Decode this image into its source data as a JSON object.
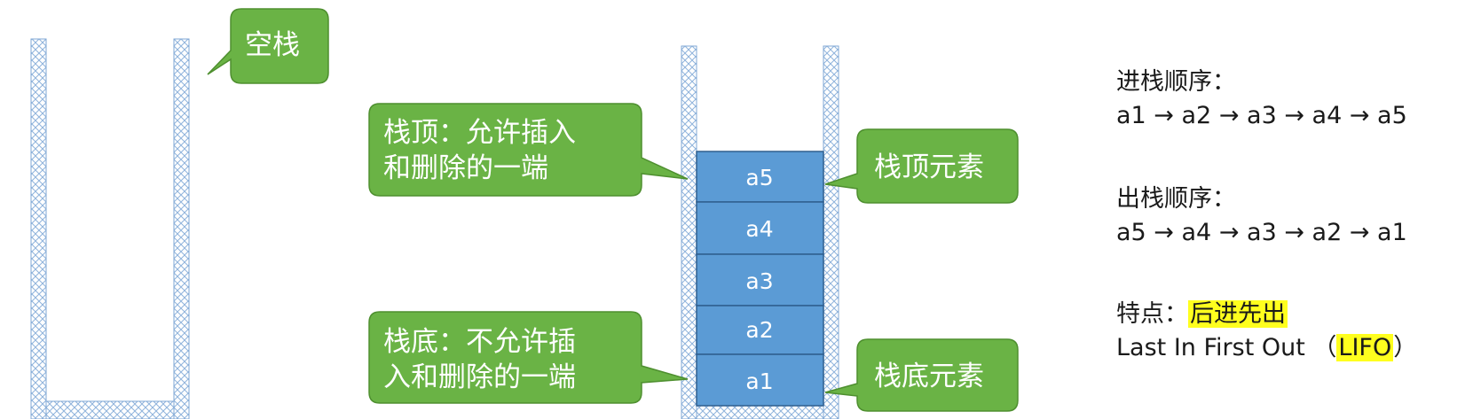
{
  "callouts": {
    "empty_stack": "空栈",
    "top_line1": "栈顶：允许插入",
    "top_line2": "和删除的一端",
    "bottom_line1": "栈底：不允许插",
    "bottom_line2": "入和删除的一端",
    "top_element": "栈顶元素",
    "bottom_element": "栈底元素"
  },
  "stack": {
    "elements": [
      "a5",
      "a4",
      "a3",
      "a2",
      "a1"
    ]
  },
  "info": {
    "push_title": "进栈顺序：",
    "push_sequence": "a1 → a2 → a3 → a4 → a5",
    "pop_title": "出栈顺序：",
    "pop_sequence": "a5 → a4 → a3 → a2 → a1",
    "feature_label": "特点：",
    "feature_value": "后进先出",
    "lifo_prefix": "Last In First Out （",
    "lifo_value": "LIFO",
    "lifo_suffix": "）"
  },
  "colors": {
    "callout_fill": "#6ab345",
    "callout_stroke": "#4e8f2f",
    "cell_fill": "#5b9bd5",
    "cell_stroke": "#2f5f8f",
    "wall_stroke": "#7fa7d4",
    "highlight": "#ffff1e"
  }
}
